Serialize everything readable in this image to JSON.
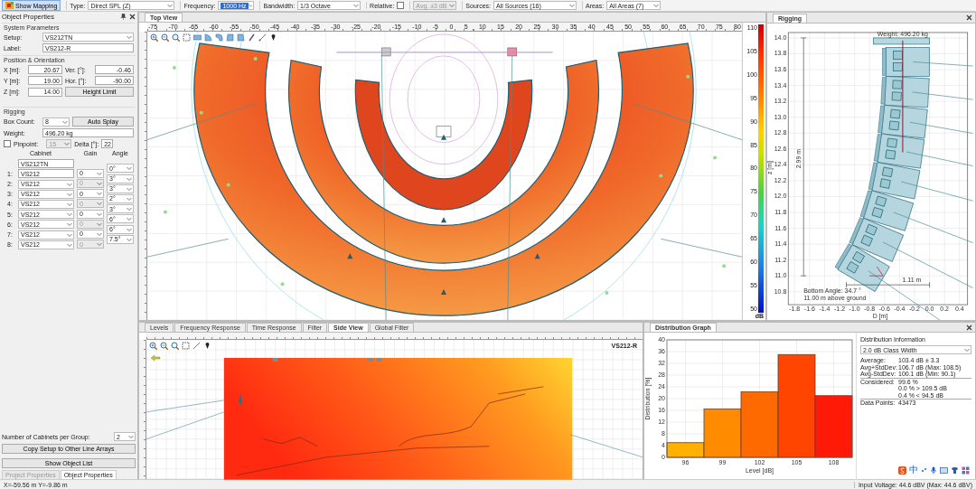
{
  "toolbar": {
    "mapping_button": {
      "label": "Show Mapping",
      "pressed": true
    },
    "fields": [
      {
        "kind": "dropdown",
        "label": "Type:",
        "value": "Direct SPL (Z)",
        "highlighted": false,
        "disabled": false
      },
      {
        "kind": "dropdown",
        "label": "Frequency:",
        "value": "1000 Hz",
        "highlighted": true,
        "disabled": false
      },
      {
        "kind": "dropdown",
        "label": "Bandwidth:",
        "value": "1/3 Octave",
        "highlighted": false,
        "disabled": false
      },
      {
        "kind": "checkbox",
        "label": "Relative:",
        "checked": false
      },
      {
        "kind": "dropdown",
        "value": "Avg. ±3 dB",
        "highlighted": false,
        "disabled": true
      },
      {
        "kind": "dropdown",
        "label": "Sources:",
        "value": "All Sources (16)",
        "highlighted": false,
        "disabled": false
      },
      {
        "kind": "dropdown",
        "label": "Areas:",
        "value": "All Areas (7)",
        "highlighted": false,
        "disabled": false
      }
    ]
  },
  "object_properties": {
    "title": "Object Properties",
    "system_parameters": {
      "title": "System Parameters",
      "setup": {
        "label": "Setup:",
        "value": "VS212TN"
      },
      "name": {
        "label": "Label:",
        "value": "VS212-R"
      }
    },
    "position": {
      "title": "Position & Orientation",
      "fields": [
        {
          "label": "X [m]:",
          "value": "20.67"
        },
        {
          "label": "Ver. [°]:",
          "value": "-0.46"
        },
        {
          "label": "Y [m]:",
          "value": "19.00"
        },
        {
          "label": "Hor. [°]:",
          "value": "-90.00"
        },
        {
          "label": "Z [m]:",
          "value": "14.00"
        }
      ],
      "button": "Height Limit"
    },
    "rigging": {
      "title": "Rigging",
      "box_count": {
        "label": "Box Count:",
        "value": "8"
      },
      "auto_button": "Auto Splay",
      "weight": {
        "label": "Weight:",
        "value": "496.20 kg"
      },
      "pinpoint": {
        "label": "Pinpoint:",
        "checked": false,
        "value": "15",
        "disabled": true
      },
      "delta": {
        "label": "Delta [°]:",
        "value": "22"
      },
      "columns": [
        "Cabinet",
        "Gain",
        "Angle"
      ],
      "type_value": "VS212TN",
      "cabinets": [
        {
          "index": "1:",
          "value": "VS212",
          "kind": "field"
        },
        {
          "index": "2:",
          "value": "VS212",
          "kind": "dropdown"
        },
        {
          "index": "3:",
          "value": "VS212",
          "kind": "dropdown"
        },
        {
          "index": "4:",
          "value": "VS212",
          "kind": "dropdown"
        },
        {
          "index": "5:",
          "value": "VS212",
          "kind": "dropdown"
        },
        {
          "index": "6:",
          "value": "VS212",
          "kind": "dropdown"
        },
        {
          "index": "7:",
          "value": "VS212",
          "kind": "dropdown"
        },
        {
          "index": "8:",
          "value": "VS212",
          "kind": "dropdown"
        }
      ],
      "gains": [
        {
          "value": "0",
          "disabled": false
        },
        {
          "value": "0",
          "disabled": true
        },
        {
          "value": "0",
          "disabled": false
        },
        {
          "value": "0",
          "disabled": true
        },
        {
          "value": "0",
          "disabled": false
        },
        {
          "value": "0",
          "disabled": true
        },
        {
          "value": "0",
          "disabled": false
        },
        {
          "value": "0",
          "disabled": true
        }
      ],
      "angles": [
        "0°",
        "3°",
        "3°",
        "2°",
        "3°",
        "6°",
        "6°",
        "7.5°"
      ]
    },
    "group": {
      "label": "Number of Cabinets per Group:",
      "value": "2"
    },
    "copy_button": "Copy Setup to Other Line Arrays",
    "list_button": "Show Object List"
  },
  "left_tabs": [
    {
      "label": "Project Properties",
      "selected": false
    },
    {
      "label": "Object Properties",
      "selected": true
    }
  ],
  "top_view": {
    "tab": "Top View",
    "ruler": [
      "-75",
      "-70",
      "-65",
      "-60",
      "-55",
      "-50",
      "-45",
      "-40",
      "-35",
      "-30",
      "-25",
      "-20",
      "-15",
      "-10",
      "-5",
      "0",
      "5",
      "10",
      "15",
      "20",
      "25",
      "30",
      "35",
      "40",
      "45",
      "50",
      "55",
      "60",
      "65",
      "70",
      "75",
      "80"
    ],
    "colorbar": {
      "labels": [
        "110",
        "105",
        "100",
        "95",
        "90",
        "85",
        "80",
        "75",
        "70",
        "65",
        "60",
        "55",
        "50"
      ],
      "unit": "dB"
    }
  },
  "rigging_view": {
    "tab": "Rigging",
    "weight": "Weight: 496.20 kg",
    "height": "2.99 m",
    "width": "1.11 m",
    "bottom_angle": "Bottom Angle: 34.7 °",
    "above_ground": "11.00 m above ground",
    "ylabel": "z [m]",
    "xlabel": "D [m]",
    "yticks": [
      "14.0",
      "13.8",
      "13.6",
      "13.4",
      "13.2",
      "13.0",
      "12.8",
      "12.6",
      "12.4",
      "12.2",
      "12.0",
      "11.8",
      "11.6",
      "11.4",
      "11.2",
      "11.0",
      "10.8"
    ],
    "xticks": [
      "-1.8",
      "-1.6",
      "-1.4",
      "-1.2",
      "-1.0",
      "-0.8",
      "-0.6",
      "-0.4",
      "-0.2",
      "0.0",
      "0.2",
      "0.4"
    ]
  },
  "bottom_tabs": [
    {
      "label": "Levels",
      "selected": false
    },
    {
      "label": "Frequency Response",
      "selected": false
    },
    {
      "label": "Time Response",
      "selected": false
    },
    {
      "label": "Filter",
      "selected": false
    },
    {
      "label": "Side View",
      "selected": true
    },
    {
      "label": "Global Filter",
      "selected": false
    }
  ],
  "side_view": {
    "label": "VS212-R"
  },
  "distribution": {
    "tab": "Distribution Graph",
    "chart_data": {
      "type": "bar",
      "xlabel": "Level [dB]",
      "ylabel": "Distribution [%]",
      "categories": [
        "96",
        "99",
        "102",
        "105",
        "108"
      ],
      "series": [
        {
          "values": [
            5,
            16.5,
            22.3,
            35,
            21
          ]
        }
      ],
      "grid": true,
      "colors": [
        "#ffb000",
        "#ff8c00",
        "#ff6a00",
        "#ff4500",
        "#ff1a08"
      ],
      "ylim": [
        0,
        40
      ],
      "yticks": [
        0,
        4,
        8,
        12,
        16,
        20,
        24,
        28,
        32,
        36,
        40
      ]
    },
    "info": {
      "title": "Distribution Information",
      "class_width": "2.0 dB Class Width",
      "rows": [
        {
          "label": "Average:",
          "value": "103.4 dB ± 3.3",
          "divider": false
        },
        {
          "label": "Avg+StdDev:",
          "value": "106.7 dB (Max: 108.5)",
          "divider": false
        },
        {
          "label": "Avg-StdDev:",
          "value": "100.1 dB (Min: 90.1)",
          "divider": false
        },
        {
          "label": "Considered:",
          "value": "99.6 %",
          "divider": true
        },
        {
          "value": "0.0 % > 109.5 dB",
          "divider": false
        },
        {
          "value": "0.4 % < 94.5 dB",
          "divider": false
        },
        {
          "label": "Data Points:",
          "value": "43473",
          "divider": true
        }
      ]
    }
  },
  "ime_bar": {
    "label": "中"
  },
  "status_bar": {
    "coordinates": "X=-59.56 m Y=-9.86 m",
    "voltage": "Input Voltage: 44.6 dBV (Max: 44.6 dBV)"
  }
}
